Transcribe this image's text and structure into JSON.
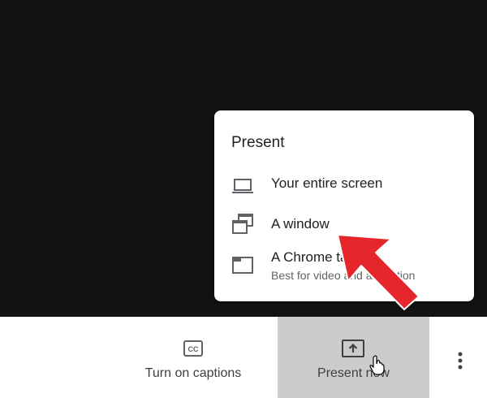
{
  "present_menu": {
    "title": "Present",
    "items": [
      {
        "label": "Your entire screen",
        "icon": "laptop-icon"
      },
      {
        "label": "A window",
        "icon": "window-icon"
      },
      {
        "label": "A Chrome tab",
        "sublabel": "Best for video and animation",
        "icon": "chrome-tab-icon"
      }
    ]
  },
  "toolbar": {
    "captions_label": "Turn on captions",
    "present_label": "Present now",
    "captions_icon": "closed-captions-icon",
    "present_icon": "present-screen-icon",
    "more_icon": "more-options-icon"
  },
  "colors": {
    "background": "#121212",
    "menu_bg": "#ffffff",
    "active_button_bg": "#cccccc",
    "annotation_arrow": "#e5262b",
    "icon_gray": "#5f6368"
  }
}
